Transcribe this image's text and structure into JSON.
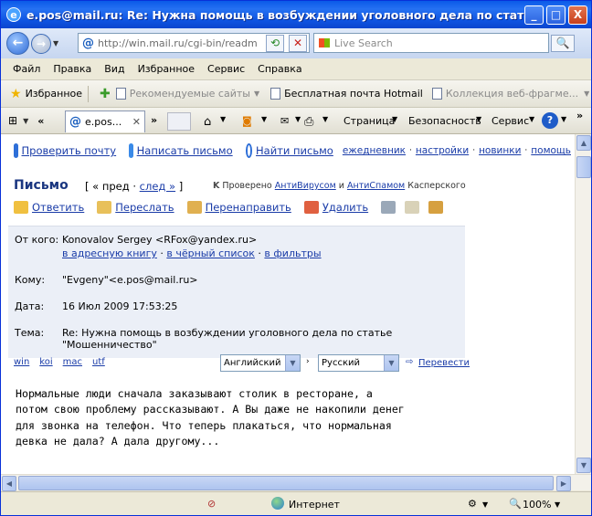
{
  "window": {
    "title": "e.pos@mail.ru: Re: Нужна помощь в возбуждении уголовного дела по статье \"Мош...",
    "btn_min": "_",
    "btn_max": "□",
    "btn_close": "X"
  },
  "navbar": {
    "back": "←",
    "forward": "→",
    "url": "http://win.mail.ru/cgi-bin/readm",
    "search_placeholder": "Live Search"
  },
  "menu": [
    "Файл",
    "Правка",
    "Вид",
    "Избранное",
    "Сервис",
    "Справка"
  ],
  "favbar": {
    "favorites": "Избранное",
    "items": [
      "Рекомендуемые сайты",
      "Бесплатная почта Hotmail",
      "Коллекция веб-фрагме..."
    ]
  },
  "tabbar": {
    "tab_label": "e.pos...",
    "tab_close": "✕",
    "commands": [
      "Страница",
      "Безопасность",
      "Сервис"
    ]
  },
  "mail": {
    "topnav": {
      "check": "Проверить почту",
      "compose": "Написать письмо",
      "find": "Найти письмо",
      "links": [
        "ежедневник",
        "настройки",
        "новинки",
        "помощь"
      ]
    },
    "heading": "Письмо",
    "prev": "« пред",
    "next": "след »",
    "checked_text": "Проверено",
    "antivirus": "АнтиВирусом",
    "and": "и",
    "antispam": "АнтиСпамом",
    "kaspersky": "Касперского",
    "actions": [
      "Ответить",
      "Переслать",
      "Перенаправить",
      "Удалить"
    ],
    "headers": {
      "from_label": "От кого:",
      "from_value": "Konovalov Sergey <RFox@yandex.ru>",
      "from_links": [
        "в адресную книгу",
        "в чёрный список",
        "в фильтры"
      ],
      "to_label": "Кому:",
      "to_value": "\"Evgeny\"<e.pos@mail.ru>",
      "date_label": "Дата:",
      "date_value": "16 Июл 2009 17:53:25",
      "subject_label": "Тема:",
      "subject_line1": "Re: Нужна помощь в возбуждении уголовного дела по статье",
      "subject_line2": "\"Мошенничество\""
    },
    "encodings": [
      "win",
      "koi",
      "mac",
      "utf"
    ],
    "translate_from": "Английский",
    "translate_to": "Русский",
    "translate_button": "Перевести",
    "body": "Нормальные люди сначала заказывают столик в ресторане, а\nпотом свою проблему рассказывают. А Вы даже не накопили денег\nдля звонка на телефон. Что теперь плакаться, что нормальная\nдевка не дала? А дала другому..."
  },
  "status": {
    "zone": "Интернет",
    "zoom": "100%"
  }
}
